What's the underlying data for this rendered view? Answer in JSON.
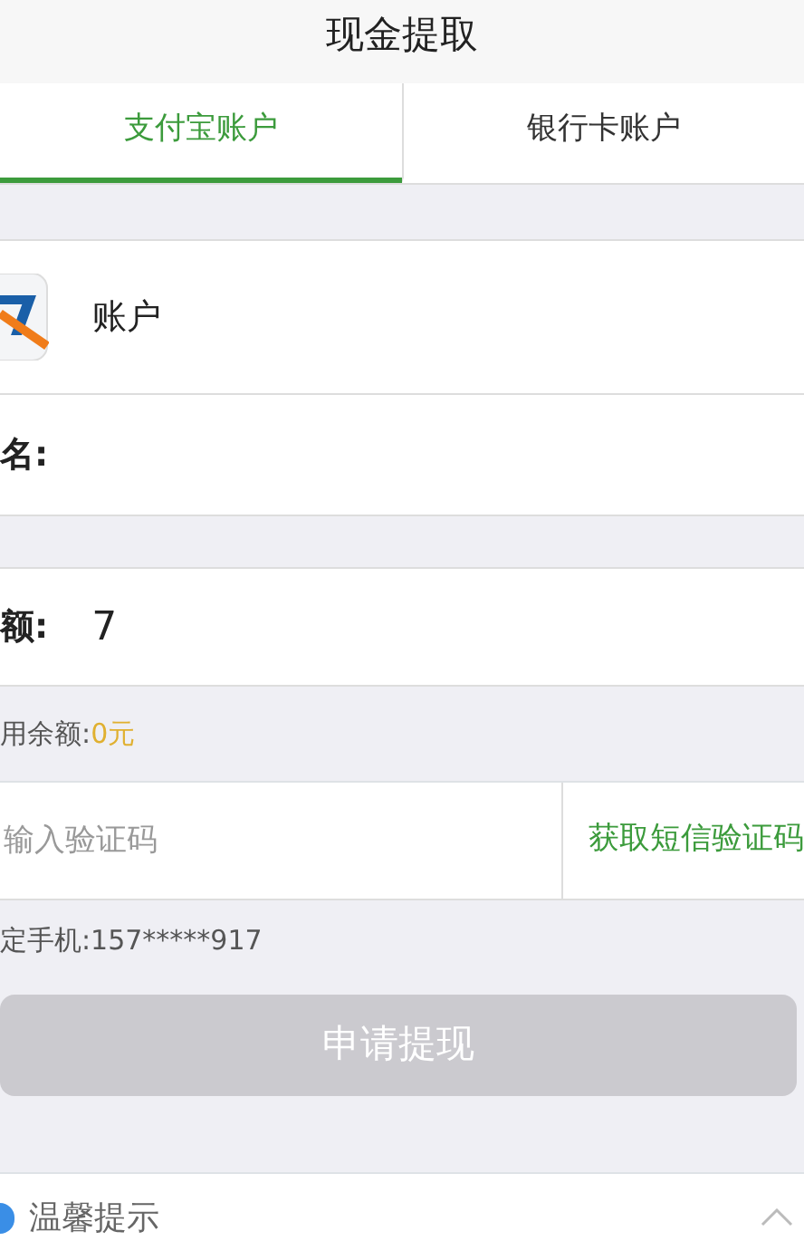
{
  "header": {
    "title": "现金提取"
  },
  "tabs": [
    {
      "label": "支付宝账户",
      "selected": true
    },
    {
      "label": "银行卡账户",
      "selected": false
    }
  ],
  "account": {
    "label": "账户"
  },
  "name_row": {
    "label": "名:"
  },
  "amount": {
    "label": "额:",
    "value": "7"
  },
  "balance": {
    "label": "用余额:",
    "value": "0元"
  },
  "code": {
    "placeholder": "输入验证码",
    "button": "获取短信验证码"
  },
  "phone": {
    "text": "定手机:157*****917"
  },
  "submit": {
    "label": "申请提现",
    "disabled": true
  },
  "tips": {
    "label": "温馨提示",
    "expanded": true
  }
}
